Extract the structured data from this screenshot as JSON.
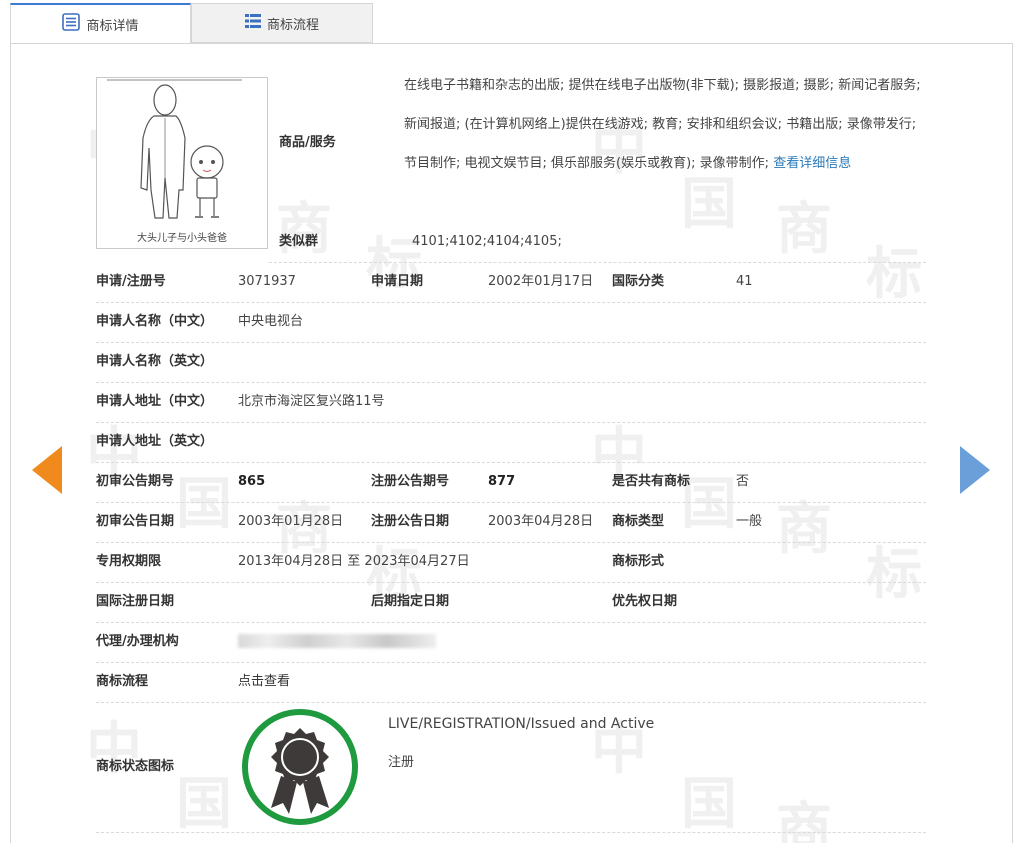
{
  "tabs": [
    {
      "label": "商标详情",
      "icon": "list-icon"
    },
    {
      "label": "商标流程",
      "icon": "grid-icon"
    }
  ],
  "logo": {
    "caption": "大头儿子与小头爸爸"
  },
  "goods": {
    "label": "商品/服务",
    "text": "在线电子书籍和杂志的出版; 提供在线电子出版物(非下载); 摄影报道; 摄影; 新闻记者服务; 新闻报道; (在计算机网络上)提供在线游戏; 教育; 安排和组织会议; 书籍出版; 录像带发行; 节目制作; 电视文娱节目; 俱乐部服务(娱乐或教育); 录像带制作; ",
    "more_link": "查看详细信息"
  },
  "similar_group": {
    "label": "类似群",
    "value": "4101;4102;4104;4105;"
  },
  "fields": {
    "reg_no_label": "申请/注册号",
    "reg_no": "3071937",
    "app_date_label": "申请日期",
    "app_date": "2002年01月17日",
    "intl_class_label": "国际分类",
    "intl_class": "41",
    "applicant_cn_label": "申请人名称（中文）",
    "applicant_cn": "中央电视台",
    "applicant_en_label": "申请人名称（英文）",
    "addr_cn_label": "申请人地址（中文）",
    "addr_cn": "北京市海淀区复兴路11号",
    "addr_en_label": "申请人地址（英文）",
    "prelim_no_label": "初审公告期号",
    "prelim_no": "865",
    "reg_pub_no_label": "注册公告期号",
    "reg_pub_no": "877",
    "shared_label": "是否共有商标",
    "shared": "否",
    "prelim_date_label": "初审公告日期",
    "prelim_date": "2003年01月28日",
    "reg_pub_date_label": "注册公告日期",
    "reg_pub_date": "2003年04月28日",
    "type_label": "商标类型",
    "type": "一般",
    "exclusive_label": "专用权期限",
    "exclusive": "2013年04月28日 至 2023年04月27日",
    "form_label": "商标形式",
    "intl_reg_date_label": "国际注册日期",
    "later_desig_label": "后期指定日期",
    "priority_label": "优先权日期",
    "agent_label": "代理/办理机构",
    "process_label": "商标流程",
    "process_link": "点击查看",
    "status_label": "商标状态图标",
    "status_en": "LIVE/REGISTRATION/Issued and Active",
    "status_cn": "注册"
  },
  "colors": {
    "accent": "#3b7bd4",
    "link": "#2a7ab8",
    "left_arrow": "#f08a1c",
    "right_arrow": "#6a9fd9",
    "status_ring": "#1f9a3e",
    "seal": "#3e3a39"
  },
  "watermark": [
    "中",
    "国",
    "商",
    "标"
  ]
}
